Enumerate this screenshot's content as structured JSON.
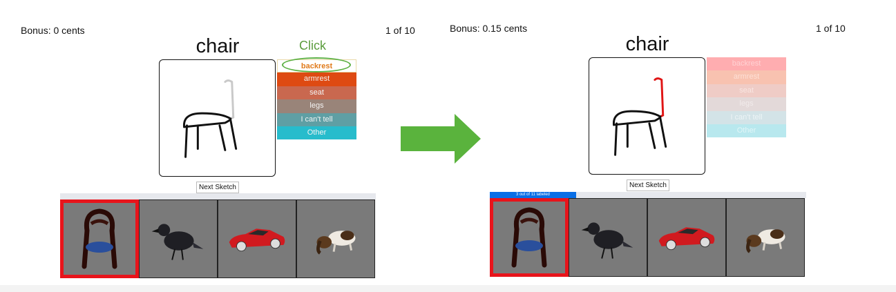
{
  "left": {
    "bonus": "Bonus: 0 cents",
    "counter": "1 of 10",
    "category": "chair",
    "click_hint": "Click",
    "parts": [
      {
        "label": "backrest",
        "bg": "#ffffff",
        "fg": "#e07a1a"
      },
      {
        "label": "armrest",
        "bg": "#de4a12",
        "fg": "#f3f3f3"
      },
      {
        "label": "seat",
        "bg": "#c9684f",
        "fg": "#f3f3f3"
      },
      {
        "label": "legs",
        "bg": "#998479",
        "fg": "#f3f3f3"
      },
      {
        "label": "I can't tell",
        "bg": "#5f9fa4",
        "fg": "#f3f3f3"
      },
      {
        "label": "Other",
        "bg": "#27bccc",
        "fg": "#f3f3f3"
      }
    ],
    "next_button": "Next Sketch"
  },
  "right": {
    "bonus": "Bonus: 0.15 cents",
    "counter": "1 of 10",
    "category": "chair",
    "parts": [
      {
        "label": "backrest",
        "bg": "#ffadb0",
        "fg": "#ffd2d4"
      },
      {
        "label": "armrest",
        "bg": "#f8c2b0",
        "fg": "#fde0d6"
      },
      {
        "label": "seat",
        "bg": "#efccc6",
        "fg": "#f8e6e2"
      },
      {
        "label": "legs",
        "bg": "#e3d9d9",
        "fg": "#f1ebeb"
      },
      {
        "label": "I can't tell",
        "bg": "#d3e3e7",
        "fg": "#edf4f6"
      },
      {
        "label": "Other",
        "bg": "#b8e8ee",
        "fg": "#e2f6f8"
      }
    ],
    "next_button": "Next Sketch",
    "progress_text": "3 out of 11 labeled",
    "progress_fraction": 0.2727
  },
  "colors": {
    "accent_green": "#5cb043",
    "selection_red": "#e8141b",
    "progress_blue": "#0a6fe6",
    "thumb_bg": "#7a7a7a"
  },
  "gallery_icons": [
    "chair-render-icon",
    "crow-render-icon",
    "car-render-icon",
    "dog-render-icon"
  ]
}
